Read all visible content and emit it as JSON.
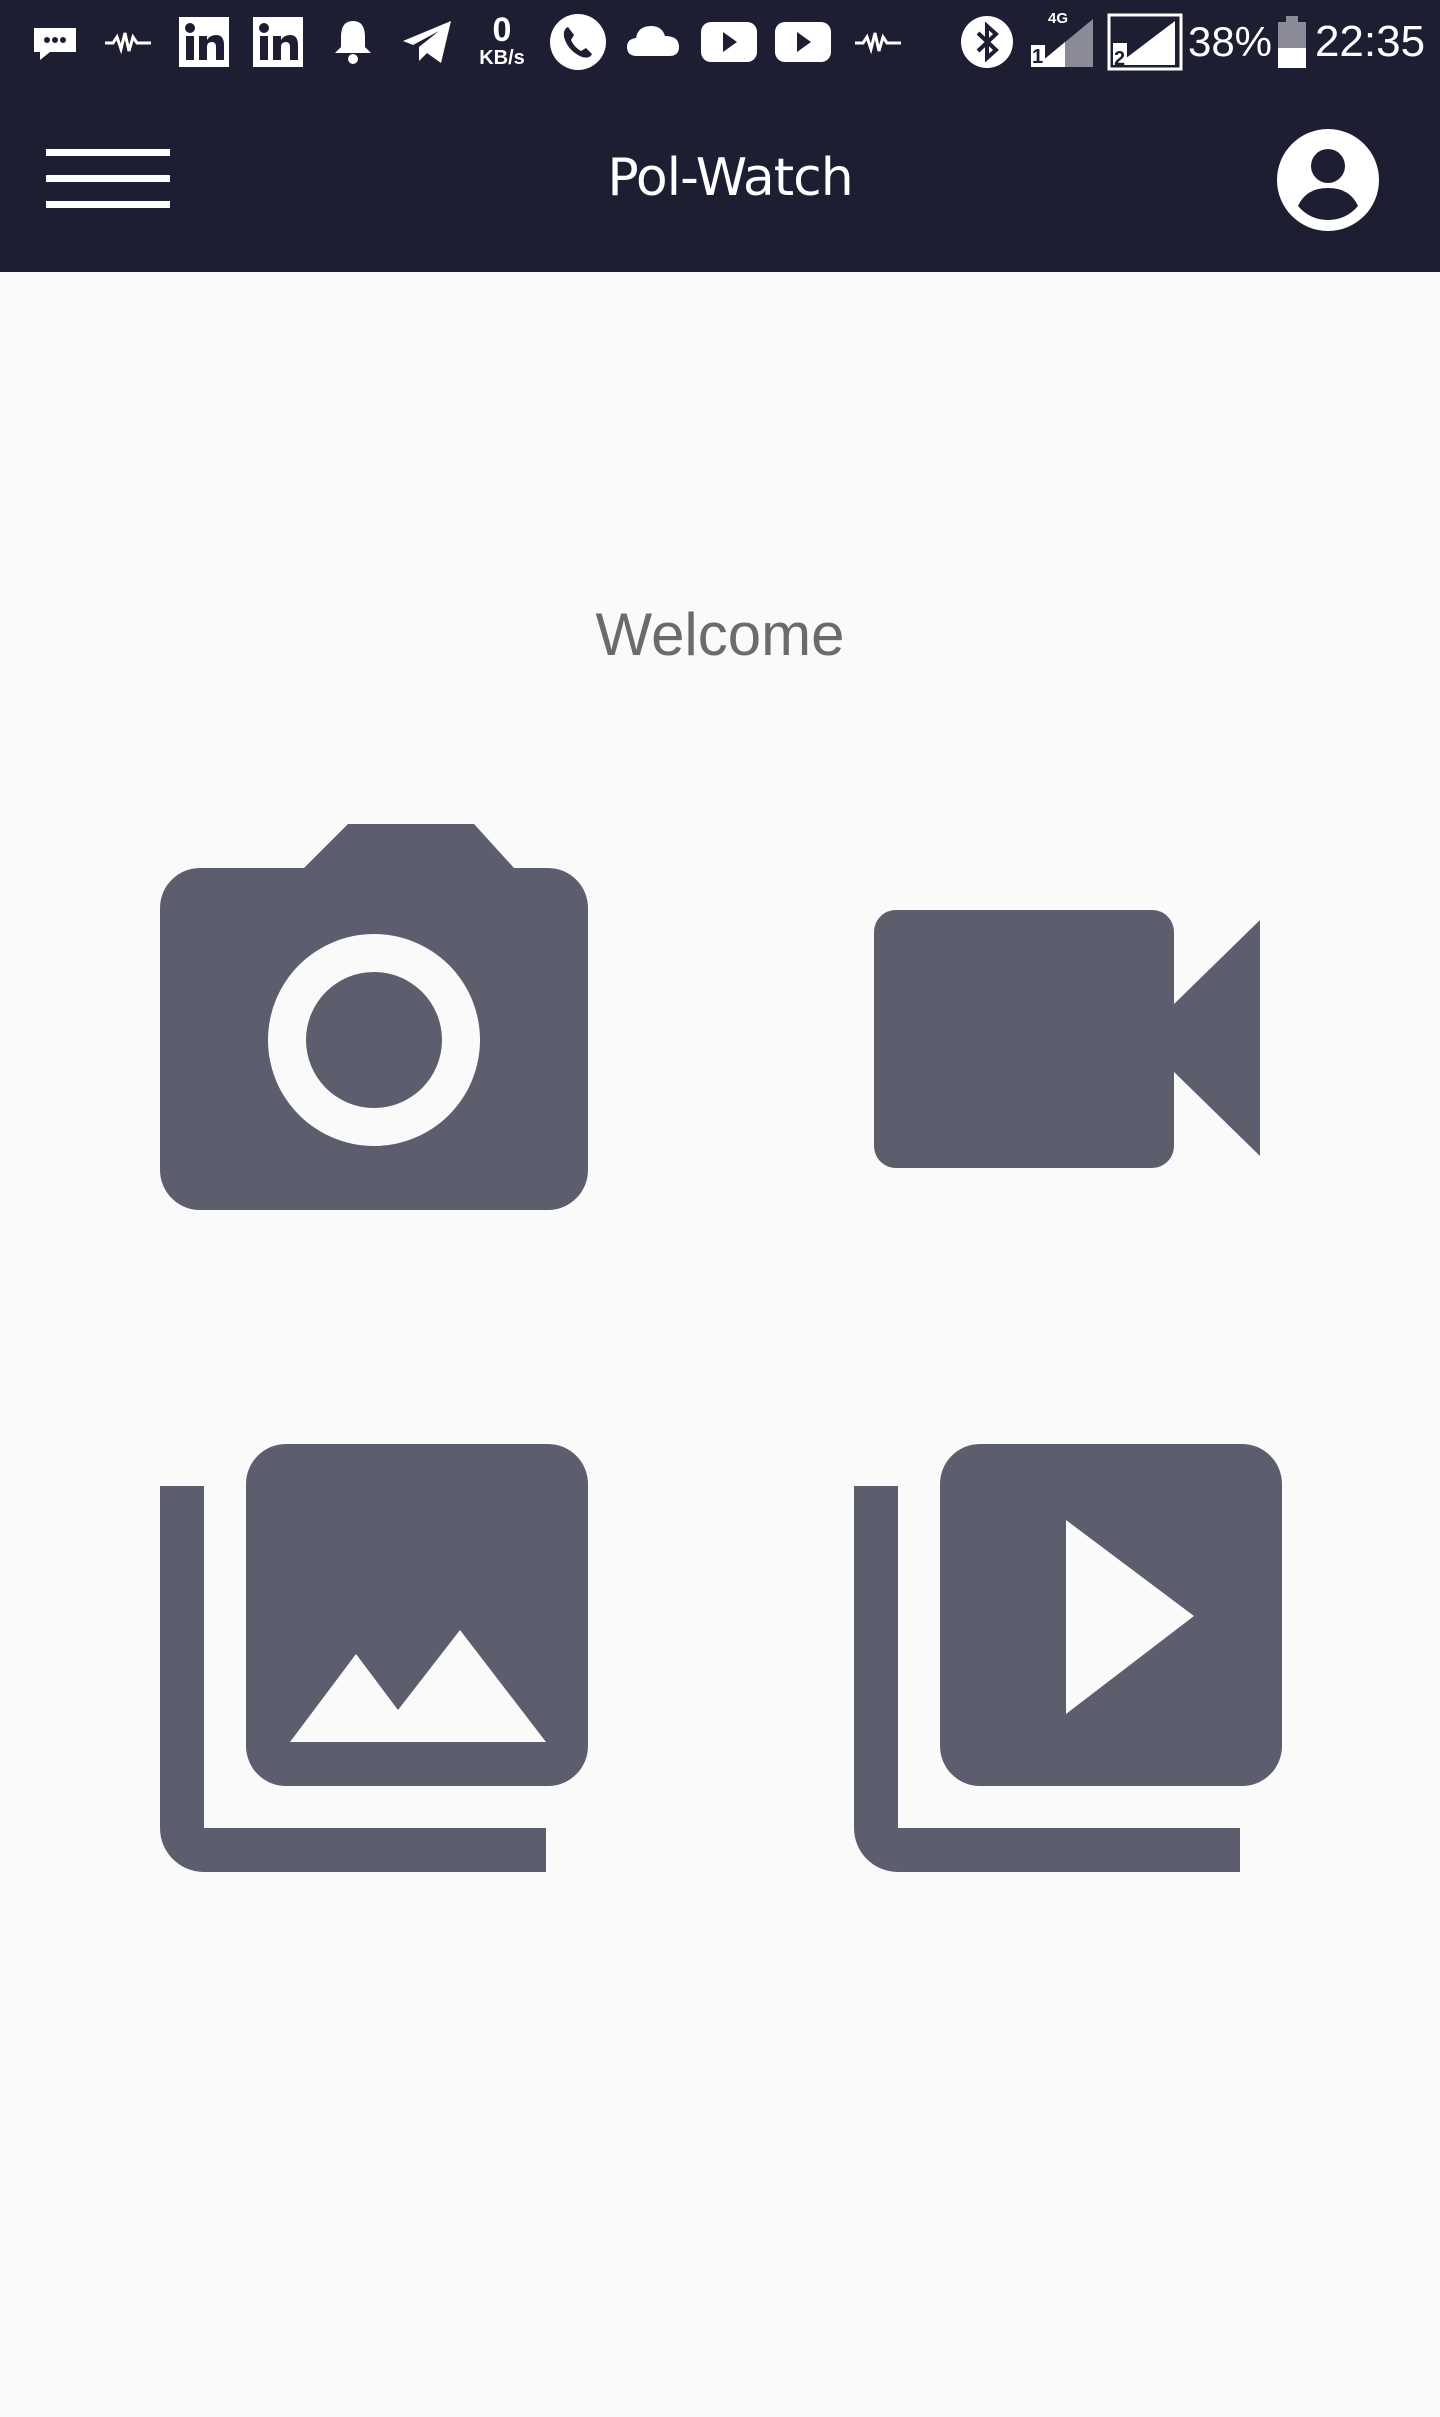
{
  "status_bar": {
    "net_speed_value": "0",
    "net_speed_unit": "KB/s",
    "sim1_network": "4G",
    "sim1_slot": "1",
    "sim2_slot": "2",
    "battery_percent": "38%",
    "time": "22:35",
    "icons": [
      "messages-icon",
      "activity-wave-icon",
      "linkedin-icon",
      "linkedin-icon",
      "bell-icon",
      "telegram-icon",
      "phone-icon",
      "cloud-icon",
      "youtube-icon",
      "youtube-icon",
      "activity-wave-icon",
      "bluetooth-icon",
      "signal-icon",
      "battery-icon"
    ]
  },
  "app_bar": {
    "title": "Pol-Watch",
    "menu_icon": "hamburger-menu-icon",
    "account_icon": "account-circle-icon"
  },
  "main": {
    "welcome_text": "Welcome",
    "actions": [
      {
        "id": "take-photo",
        "icon": "camera-icon"
      },
      {
        "id": "record-video",
        "icon": "videocam-icon"
      },
      {
        "id": "photo-library",
        "icon": "photo-library-icon"
      },
      {
        "id": "video-library",
        "icon": "video-library-icon"
      }
    ]
  },
  "colors": {
    "app_bar_background": "#1e1e33",
    "page_background": "#fafafa",
    "icon_color": "#5c5e6d",
    "welcome_text_color": "#6b6b6b",
    "on_primary": "#ffffff"
  }
}
